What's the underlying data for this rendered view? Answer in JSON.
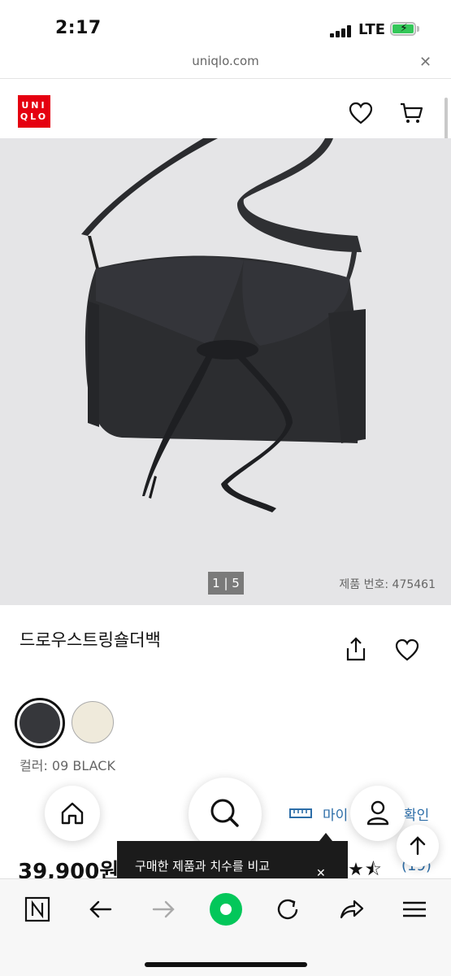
{
  "status_bar": {
    "time": "2:17",
    "network": "LTE",
    "battery_level": 1.0
  },
  "browser": {
    "url": "uniqlo.com",
    "close_glyph": "✕"
  },
  "header": {
    "logo_line1": "UNI",
    "logo_line2": "QLO",
    "brand_color": "#e50010",
    "icons": [
      "heart-icon",
      "cart-icon"
    ]
  },
  "gallery": {
    "pager": "1 | 5",
    "product_number": "제품 번호: 475461",
    "background": "#e5e5e7"
  },
  "product": {
    "title": "드로우스트링숄더백",
    "colors": [
      {
        "name": "09 BLACK",
        "hex": "#36373b",
        "selected": true
      },
      {
        "name": "cream",
        "hex": "#efeadb",
        "selected": false
      }
    ],
    "color_label": "컬러: 09 BLACK",
    "price": "39,900원",
    "rating": 4.5,
    "stars": "★★★★⯪",
    "review_count": "(19)"
  },
  "floating_nav": {
    "my_label": "마이",
    "confirm_label": "확인",
    "accent": "#2d6ea8"
  },
  "tooltip": {
    "text": "구매한 제품과 치수를 비교",
    "close": "✕"
  },
  "toolbar": {
    "icons": [
      "naver-n-icon",
      "back-arrow-icon",
      "forward-arrow-icon",
      "green-dot-icon",
      "refresh-icon",
      "share-arrow-icon",
      "menu-icon"
    ],
    "green": "#03c75a"
  }
}
